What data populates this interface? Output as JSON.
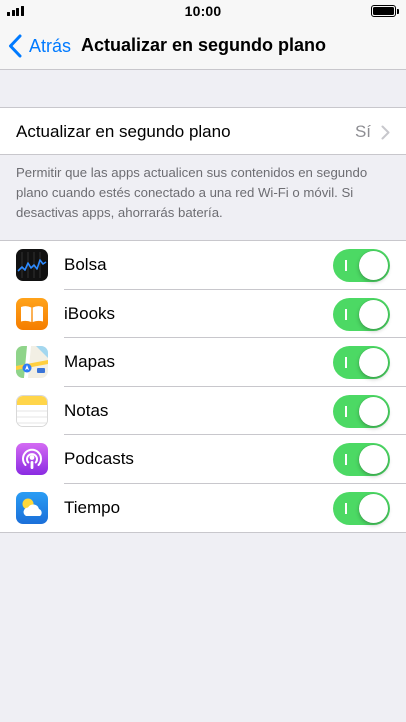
{
  "status_bar": {
    "time": "10:00",
    "signal_icon": "signal-bars-icon",
    "battery_icon": "battery-icon"
  },
  "nav": {
    "back_label": "Atrás",
    "back_icon": "chevron-left-icon",
    "title": "Actualizar en segundo plano"
  },
  "master": {
    "label": "Actualizar en segundo plano",
    "value": "Sí",
    "icon": "chevron-right-icon"
  },
  "footer": {
    "text": "Permitir que las apps actualicen sus contenidos en segundo plano cuando estés conectado a una red Wi-Fi o móvil. Si desactivas apps, ahorrarás batería."
  },
  "apps": [
    {
      "name": "Bolsa",
      "icon": "stocks-icon",
      "enabled": true
    },
    {
      "name": "iBooks",
      "icon": "ibooks-icon",
      "enabled": true
    },
    {
      "name": "Mapas",
      "icon": "maps-icon",
      "enabled": true
    },
    {
      "name": "Notas",
      "icon": "notes-icon",
      "enabled": true
    },
    {
      "name": "Podcasts",
      "icon": "podcasts-icon",
      "enabled": true
    },
    {
      "name": "Tiempo",
      "icon": "weather-icon",
      "enabled": true
    }
  ],
  "colors": {
    "accent": "#007aff",
    "toggle_on": "#4cd964",
    "background": "#efeff4",
    "secondary_text": "#8e8e93"
  }
}
